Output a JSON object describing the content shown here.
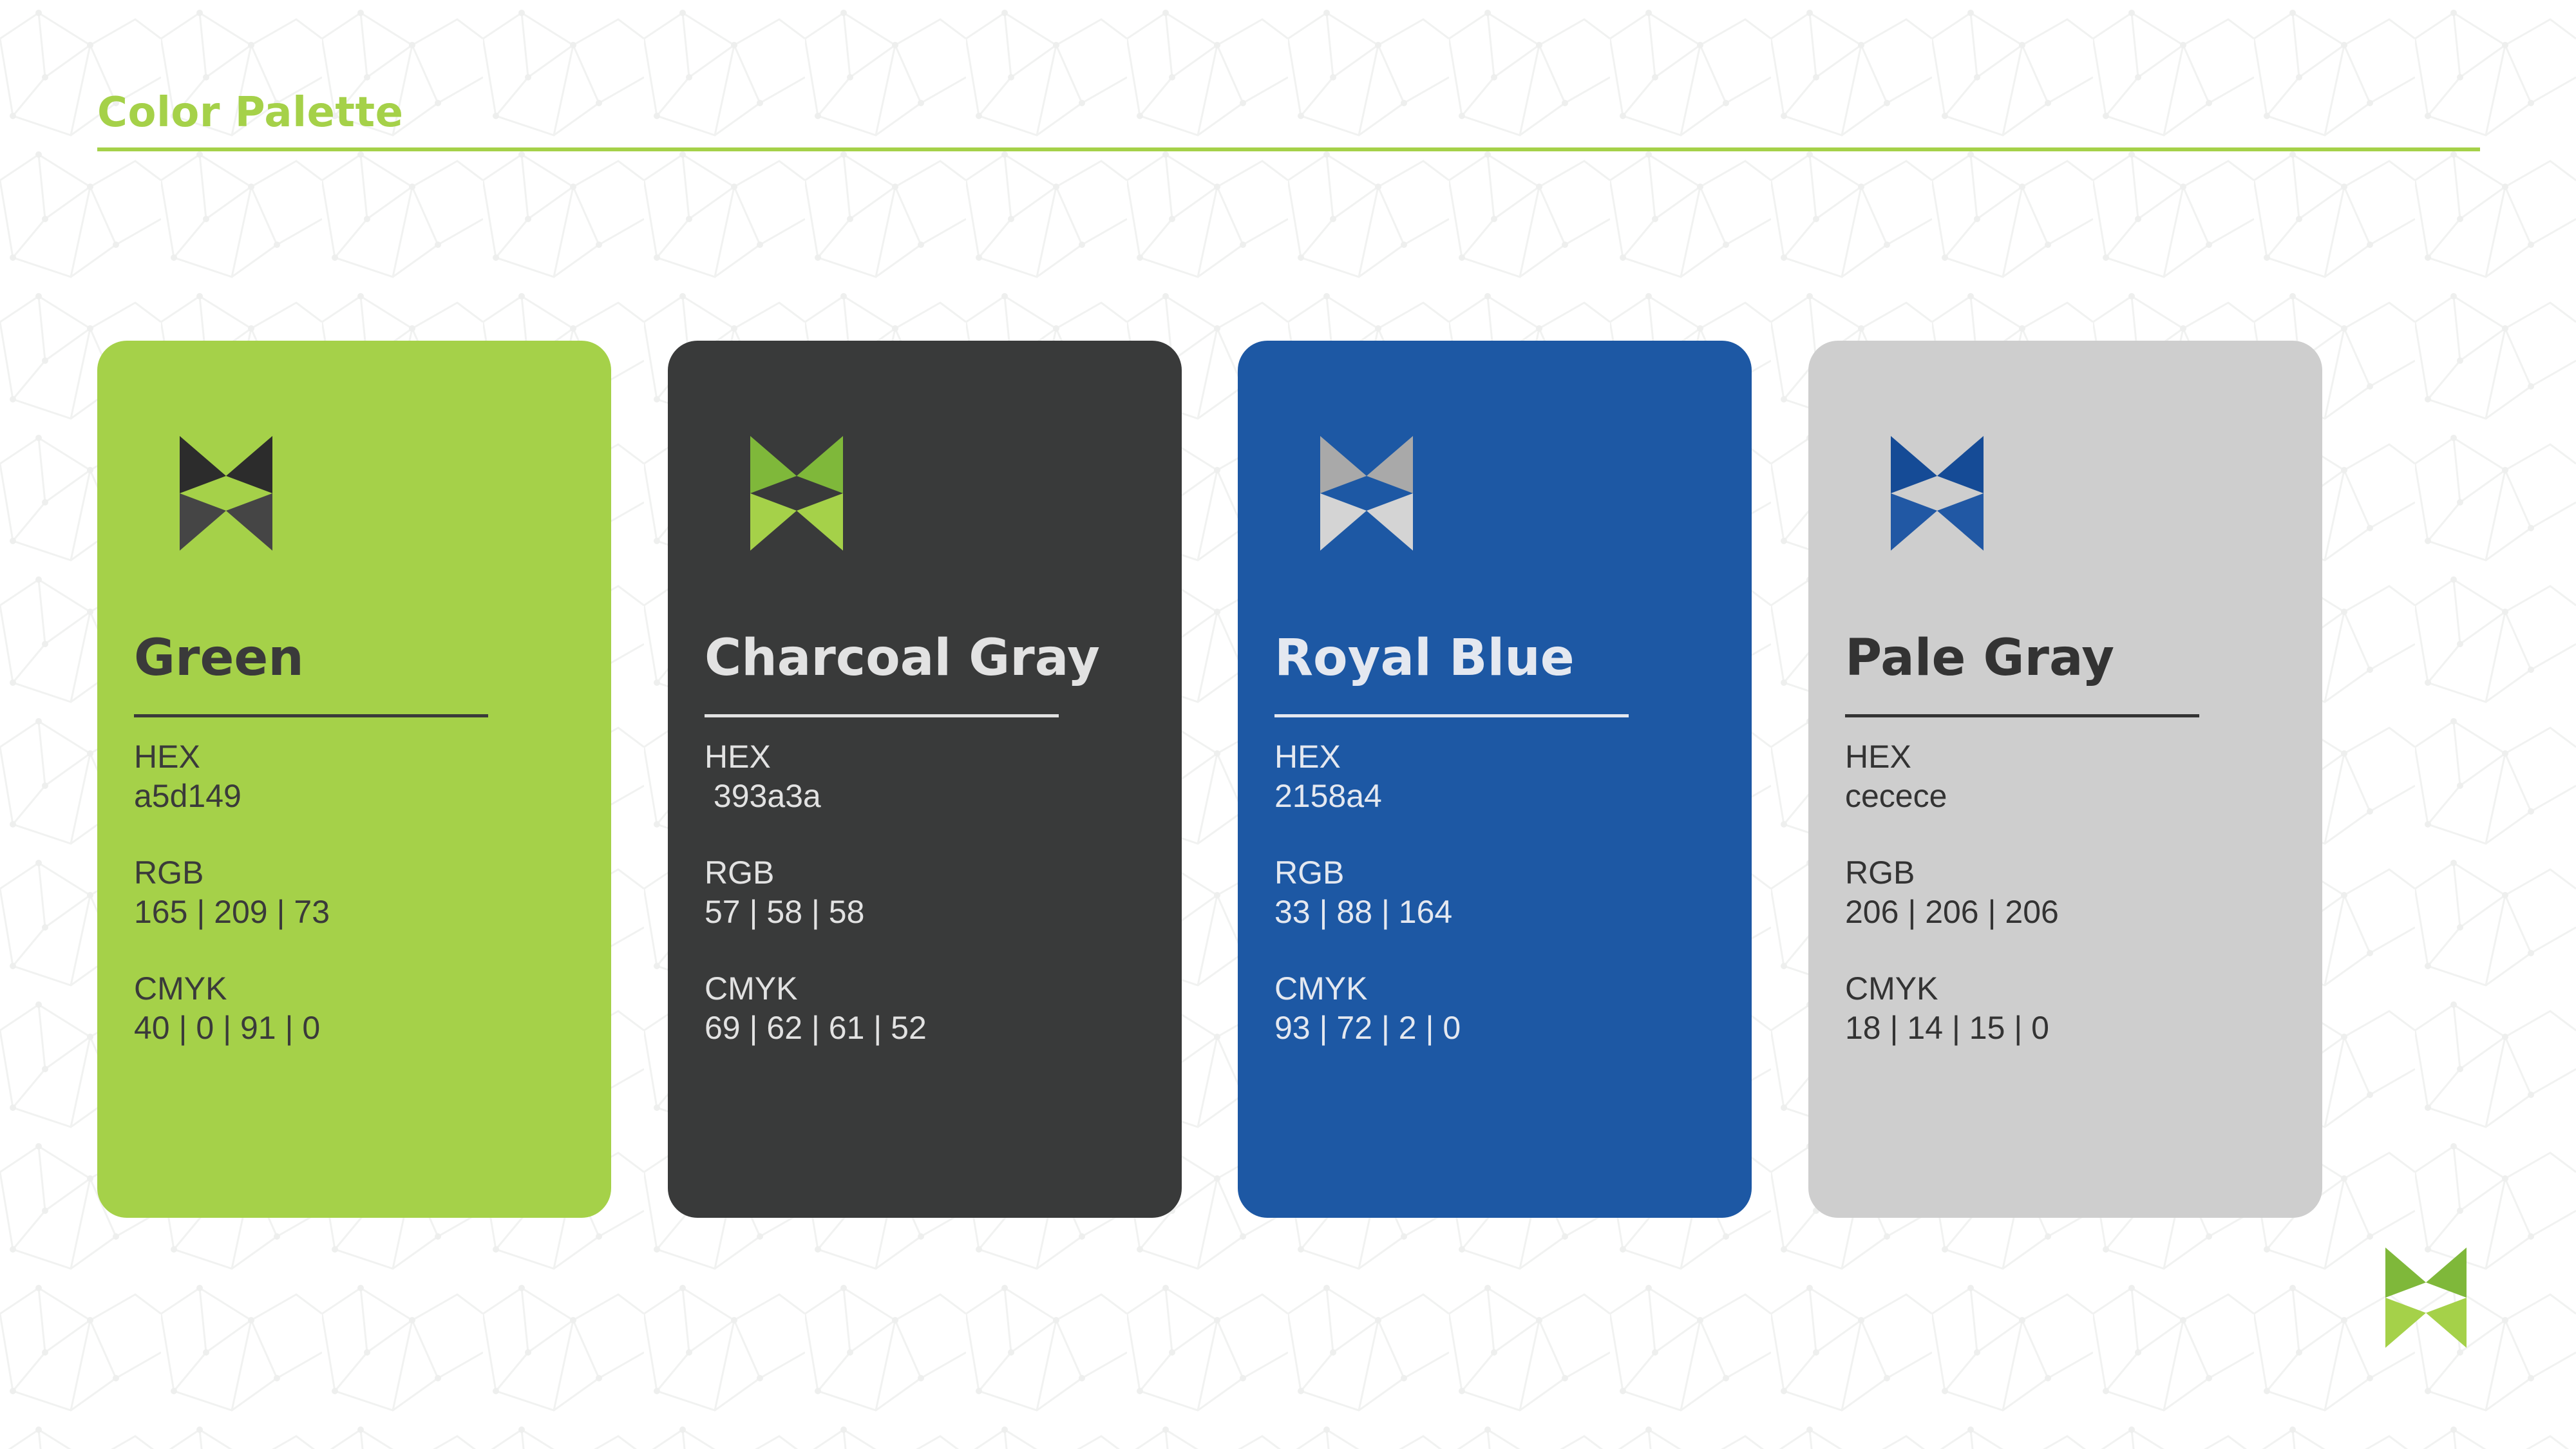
{
  "title": "Color Palette",
  "accent": "#a5d149",
  "cards": [
    {
      "name": "Green",
      "bg": "#a5d149",
      "text_color": "#3a3a3a",
      "logo_dark": "#2c2c2c",
      "logo_light": "#454545",
      "hex_label": "HEX",
      "hex_value": "a5d149",
      "rgb_label": "RGB",
      "rgb_value": "165 | 209 | 73",
      "cmyk_label": "CMYK",
      "cmyk_value": "40 | 0 | 91 | 0"
    },
    {
      "name": "Charcoal Gray",
      "bg": "#393a3a",
      "text_color": "#e2e2e2",
      "logo_dark": "#7fb83a",
      "logo_light": "#a5d149",
      "hex_label": "HEX",
      "hex_value": " 393a3a",
      "rgb_label": "RGB",
      "rgb_value": "57 | 58 | 58",
      "cmyk_label": "CMYK",
      "cmyk_value": "69 | 62 | 61 | 52"
    },
    {
      "name": "Royal Blue",
      "bg": "#1d58a4",
      "text_color": "#e4e8f0",
      "logo_dark": "#a9a9a9",
      "logo_light": "#d4d4d4",
      "hex_label": "HEX",
      "hex_value": "2158a4",
      "rgb_label": "RGB",
      "rgb_value": "33 | 88 | 164",
      "cmyk_label": "CMYK",
      "cmyk_value": "93 | 72 | 2 | 0"
    },
    {
      "name": "Pale Gray",
      "bg": "#cecece",
      "text_color": "#333333",
      "logo_dark": "#154b96",
      "logo_light": "#2158a4",
      "hex_label": "HEX",
      "hex_value": "cecece",
      "rgb_label": "RGB",
      "rgb_value": "206 | 206 | 206",
      "cmyk_label": "CMYK",
      "cmyk_value": "18 | 14 | 15 | 0"
    }
  ],
  "corner_logo": {
    "dark": "#7fb83a",
    "light": "#a5d149"
  }
}
